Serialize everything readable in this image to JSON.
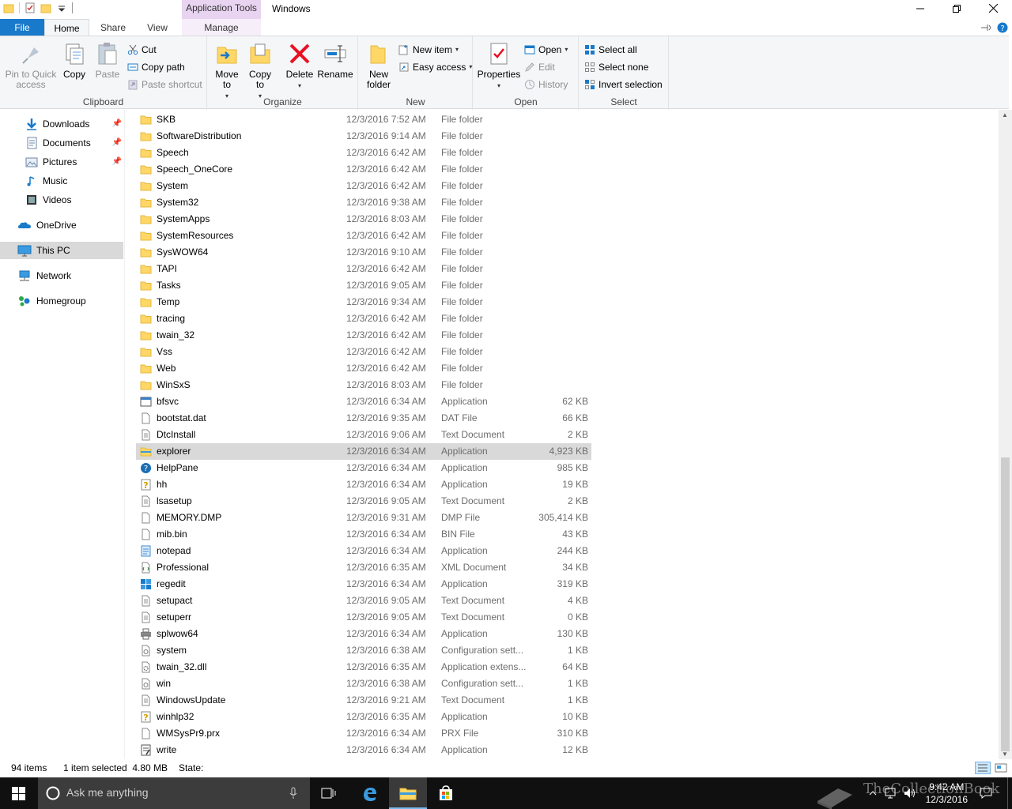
{
  "window": {
    "title": "Windows",
    "context_tab_group": "Application Tools"
  },
  "tabs": {
    "file": "File",
    "home": "Home",
    "share": "Share",
    "view": "View",
    "manage": "Manage"
  },
  "ribbon": {
    "clipboard": {
      "label": "Clipboard",
      "pin": "Pin to Quick access",
      "copy": "Copy",
      "paste": "Paste",
      "cut": "Cut",
      "copy_path": "Copy path",
      "paste_shortcut": "Paste shortcut"
    },
    "organize": {
      "label": "Organize",
      "move_to": "Move to",
      "copy_to": "Copy to",
      "delete": "Delete",
      "rename": "Rename"
    },
    "new": {
      "label": "New",
      "new_folder": "New folder",
      "new_item": "New item",
      "easy_access": "Easy access"
    },
    "open": {
      "label": "Open",
      "properties": "Properties",
      "open": "Open",
      "edit": "Edit",
      "history": "History"
    },
    "select": {
      "label": "Select",
      "select_all": "Select all",
      "select_none": "Select none",
      "invert_selection": "Invert selection"
    }
  },
  "nav": {
    "items": [
      {
        "label": "Downloads",
        "icon": "download-icon",
        "pinned": true
      },
      {
        "label": "Documents",
        "icon": "documents-icon",
        "pinned": true
      },
      {
        "label": "Pictures",
        "icon": "pictures-icon",
        "pinned": true
      },
      {
        "label": "Music",
        "icon": "music-icon",
        "pinned": false
      },
      {
        "label": "Videos",
        "icon": "videos-icon",
        "pinned": false
      },
      {
        "label": "OneDrive",
        "icon": "onedrive-icon",
        "pinned": false
      },
      {
        "label": "This PC",
        "icon": "this-pc-icon",
        "pinned": false,
        "selected": true
      },
      {
        "label": "Network",
        "icon": "network-icon",
        "pinned": false
      },
      {
        "label": "Homegroup",
        "icon": "homegroup-icon",
        "pinned": false
      }
    ]
  },
  "files": [
    {
      "name": "SKB",
      "date": "12/3/2016 7:52 AM",
      "type": "File folder",
      "size": "",
      "icon": "folder"
    },
    {
      "name": "SoftwareDistribution",
      "date": "12/3/2016 9:14 AM",
      "type": "File folder",
      "size": "",
      "icon": "folder"
    },
    {
      "name": "Speech",
      "date": "12/3/2016 6:42 AM",
      "type": "File folder",
      "size": "",
      "icon": "folder"
    },
    {
      "name": "Speech_OneCore",
      "date": "12/3/2016 6:42 AM",
      "type": "File folder",
      "size": "",
      "icon": "folder"
    },
    {
      "name": "System",
      "date": "12/3/2016 6:42 AM",
      "type": "File folder",
      "size": "",
      "icon": "folder"
    },
    {
      "name": "System32",
      "date": "12/3/2016 9:38 AM",
      "type": "File folder",
      "size": "",
      "icon": "folder"
    },
    {
      "name": "SystemApps",
      "date": "12/3/2016 8:03 AM",
      "type": "File folder",
      "size": "",
      "icon": "folder"
    },
    {
      "name": "SystemResources",
      "date": "12/3/2016 6:42 AM",
      "type": "File folder",
      "size": "",
      "icon": "folder"
    },
    {
      "name": "SysWOW64",
      "date": "12/3/2016 9:10 AM",
      "type": "File folder",
      "size": "",
      "icon": "folder"
    },
    {
      "name": "TAPI",
      "date": "12/3/2016 6:42 AM",
      "type": "File folder",
      "size": "",
      "icon": "folder"
    },
    {
      "name": "Tasks",
      "date": "12/3/2016 9:05 AM",
      "type": "File folder",
      "size": "",
      "icon": "folder"
    },
    {
      "name": "Temp",
      "date": "12/3/2016 9:34 AM",
      "type": "File folder",
      "size": "",
      "icon": "folder"
    },
    {
      "name": "tracing",
      "date": "12/3/2016 6:42 AM",
      "type": "File folder",
      "size": "",
      "icon": "folder"
    },
    {
      "name": "twain_32",
      "date": "12/3/2016 6:42 AM",
      "type": "File folder",
      "size": "",
      "icon": "folder"
    },
    {
      "name": "Vss",
      "date": "12/3/2016 6:42 AM",
      "type": "File folder",
      "size": "",
      "icon": "folder"
    },
    {
      "name": "Web",
      "date": "12/3/2016 6:42 AM",
      "type": "File folder",
      "size": "",
      "icon": "folder"
    },
    {
      "name": "WinSxS",
      "date": "12/3/2016 8:03 AM",
      "type": "File folder",
      "size": "",
      "icon": "folder"
    },
    {
      "name": "bfsvc",
      "date": "12/3/2016 6:34 AM",
      "type": "Application",
      "size": "62 KB",
      "icon": "app"
    },
    {
      "name": "bootstat.dat",
      "date": "12/3/2016 9:35 AM",
      "type": "DAT File",
      "size": "66 KB",
      "icon": "doc"
    },
    {
      "name": "DtcInstall",
      "date": "12/3/2016 9:06 AM",
      "type": "Text Document",
      "size": "2 KB",
      "icon": "text"
    },
    {
      "name": "explorer",
      "date": "12/3/2016 6:34 AM",
      "type": "Application",
      "size": "4,923 KB",
      "icon": "explorer",
      "selected": true
    },
    {
      "name": "HelpPane",
      "date": "12/3/2016 6:34 AM",
      "type": "Application",
      "size": "985 KB",
      "icon": "help"
    },
    {
      "name": "hh",
      "date": "12/3/2016 6:34 AM",
      "type": "Application",
      "size": "19 KB",
      "icon": "hh"
    },
    {
      "name": "lsasetup",
      "date": "12/3/2016 9:05 AM",
      "type": "Text Document",
      "size": "2 KB",
      "icon": "text"
    },
    {
      "name": "MEMORY.DMP",
      "date": "12/3/2016 9:31 AM",
      "type": "DMP File",
      "size": "305,414 KB",
      "icon": "doc"
    },
    {
      "name": "mib.bin",
      "date": "12/3/2016 6:34 AM",
      "type": "BIN File",
      "size": "43 KB",
      "icon": "doc"
    },
    {
      "name": "notepad",
      "date": "12/3/2016 6:34 AM",
      "type": "Application",
      "size": "244 KB",
      "icon": "notepad"
    },
    {
      "name": "Professional",
      "date": "12/3/2016 6:35 AM",
      "type": "XML Document",
      "size": "34 KB",
      "icon": "xml"
    },
    {
      "name": "regedit",
      "date": "12/3/2016 6:34 AM",
      "type": "Application",
      "size": "319 KB",
      "icon": "regedit"
    },
    {
      "name": "setupact",
      "date": "12/3/2016 9:05 AM",
      "type": "Text Document",
      "size": "4 KB",
      "icon": "text"
    },
    {
      "name": "setuperr",
      "date": "12/3/2016 9:05 AM",
      "type": "Text Document",
      "size": "0 KB",
      "icon": "text"
    },
    {
      "name": "splwow64",
      "date": "12/3/2016 6:34 AM",
      "type": "Application",
      "size": "130 KB",
      "icon": "printer"
    },
    {
      "name": "system",
      "date": "12/3/2016 6:38 AM",
      "type": "Configuration sett...",
      "size": "1 KB",
      "icon": "config"
    },
    {
      "name": "twain_32.dll",
      "date": "12/3/2016 6:35 AM",
      "type": "Application extens...",
      "size": "64 KB",
      "icon": "dll"
    },
    {
      "name": "win",
      "date": "12/3/2016 6:38 AM",
      "type": "Configuration sett...",
      "size": "1 KB",
      "icon": "config"
    },
    {
      "name": "WindowsUpdate",
      "date": "12/3/2016 9:21 AM",
      "type": "Text Document",
      "size": "1 KB",
      "icon": "text"
    },
    {
      "name": "winhlp32",
      "date": "12/3/2016 6:35 AM",
      "type": "Application",
      "size": "10 KB",
      "icon": "hh"
    },
    {
      "name": "WMSysPr9.prx",
      "date": "12/3/2016 6:34 AM",
      "type": "PRX File",
      "size": "310 KB",
      "icon": "doc"
    },
    {
      "name": "write",
      "date": "12/3/2016 6:34 AM",
      "type": "Application",
      "size": "12 KB",
      "icon": "write"
    }
  ],
  "status": {
    "item_count": "94 items",
    "selection": "1 item selected  4.80 MB",
    "state": "State:"
  },
  "taskbar": {
    "search_placeholder": "Ask me anything",
    "time": "9:42 AM",
    "date": "12/3/2016",
    "watermark": "TheCollectionBook"
  },
  "colors": {
    "accent": "#1979ca",
    "selection": "#d9d9d9",
    "folder": "#ffd767",
    "context_tab": "#e8d3f0"
  }
}
